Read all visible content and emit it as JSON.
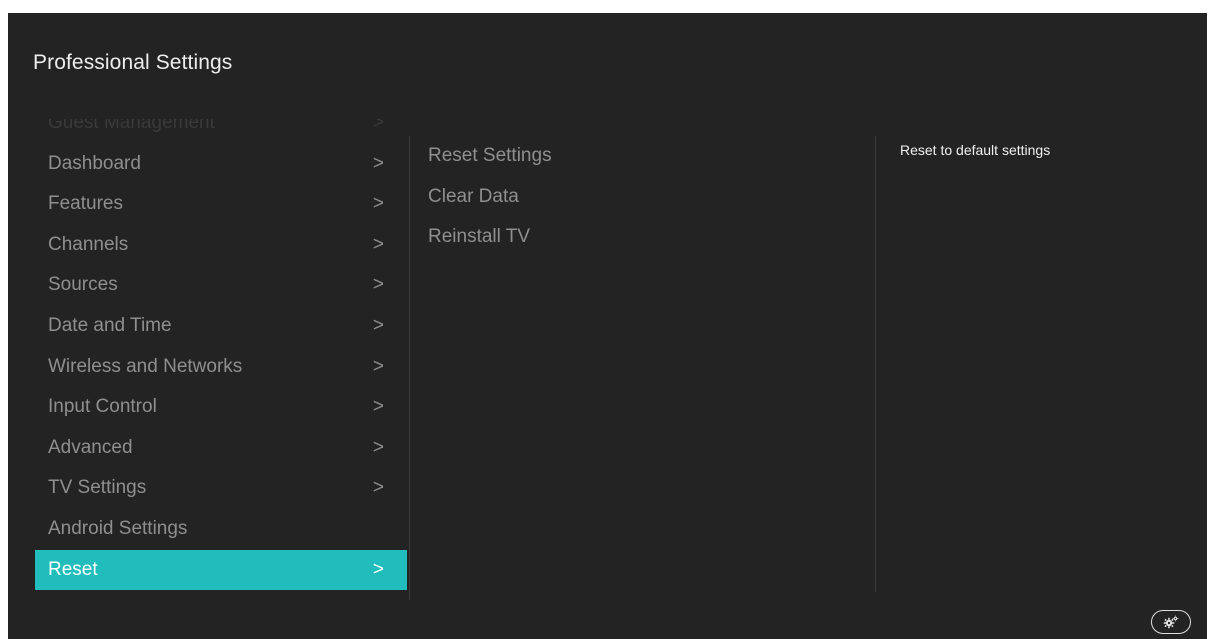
{
  "header": {
    "title": "Professional Settings"
  },
  "menu": {
    "items": [
      {
        "label": "Guest Management",
        "chevron": ">"
      },
      {
        "label": "Dashboard",
        "chevron": ">"
      },
      {
        "label": "Features",
        "chevron": ">"
      },
      {
        "label": "Channels",
        "chevron": ">"
      },
      {
        "label": "Sources",
        "chevron": ">"
      },
      {
        "label": "Date and Time",
        "chevron": ">"
      },
      {
        "label": "Wireless and Networks",
        "chevron": ">"
      },
      {
        "label": "Input Control",
        "chevron": ">"
      },
      {
        "label": "Advanced",
        "chevron": ">"
      },
      {
        "label": "TV Settings",
        "chevron": ">"
      },
      {
        "label": "Android Settings",
        "chevron": ""
      },
      {
        "label": "Reset",
        "chevron": ">"
      }
    ],
    "selected_index": 11
  },
  "submenu": {
    "items": [
      {
        "label": "Reset Settings"
      },
      {
        "label": "Clear Data"
      },
      {
        "label": "Reinstall TV"
      }
    ]
  },
  "description": {
    "text": "Reset to default settings"
  },
  "corner_button": {
    "icon": "settings-gear-icon"
  },
  "colors": {
    "background": "#232323",
    "accent": "#21bcbc",
    "text_dim": "#8f8f8f",
    "text_bright": "#ededed"
  }
}
